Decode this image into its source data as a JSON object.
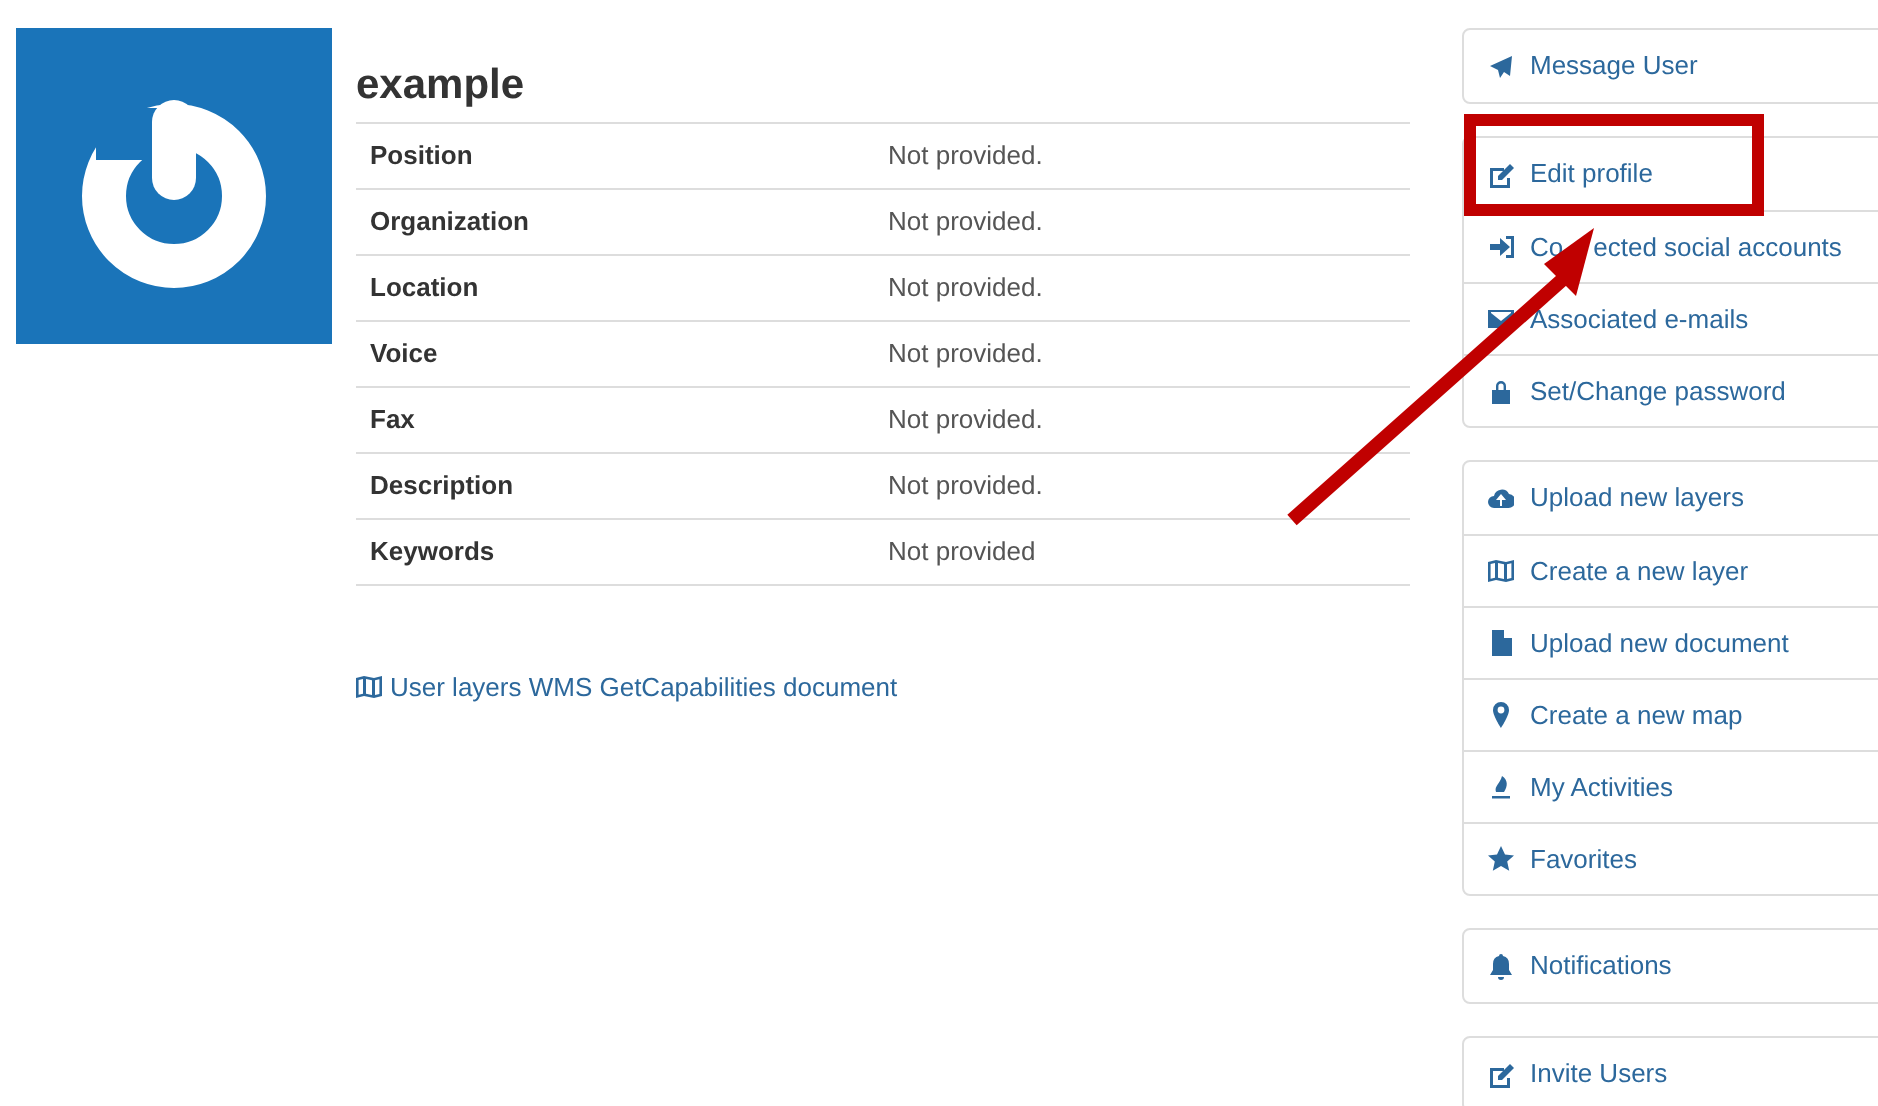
{
  "profile": {
    "name": "example"
  },
  "details": [
    {
      "label": "Position",
      "value": "Not provided."
    },
    {
      "label": "Organization",
      "value": "Not provided."
    },
    {
      "label": "Location",
      "value": "Not provided."
    },
    {
      "label": "Voice",
      "value": "Not provided."
    },
    {
      "label": "Fax",
      "value": "Not provided."
    },
    {
      "label": "Description",
      "value": "Not provided."
    },
    {
      "label": "Keywords",
      "value": "Not provided"
    }
  ],
  "wms_link": "User layers WMS GetCapabilities document",
  "sidebar_groups": [
    [
      {
        "label": "Message User"
      }
    ],
    [
      {
        "label": "Edit profile"
      },
      {
        "label_parts": [
          "Co",
          "ected social accounts"
        ]
      },
      {
        "label": "Associated e-mails"
      },
      {
        "label": "Set/Change password"
      }
    ],
    [
      {
        "label": "Upload new layers"
      },
      {
        "label": "Create a new layer"
      },
      {
        "label": "Upload new document"
      },
      {
        "label": "Create a new map"
      },
      {
        "label": "My Activities"
      },
      {
        "label": "Favorites"
      }
    ],
    [
      {
        "label": "Notifications"
      }
    ],
    [
      {
        "label": "Invite Users"
      }
    ]
  ]
}
